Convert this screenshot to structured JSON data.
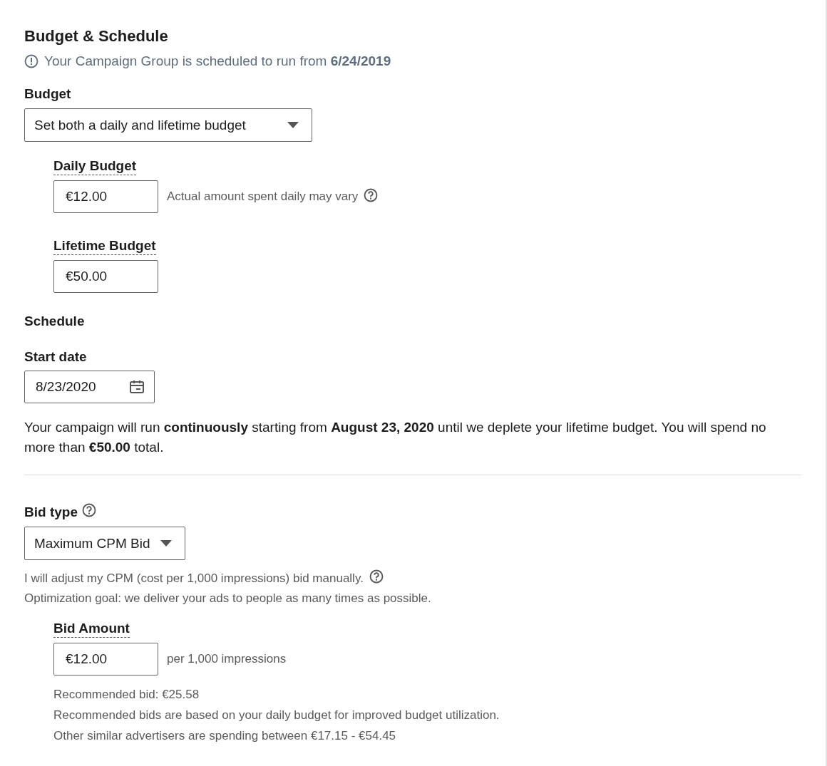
{
  "section": {
    "title": "Budget & Schedule",
    "notice": "Your Campaign Group is scheduled to run from **6/24/2019**"
  },
  "budget": {
    "label": "Budget",
    "select": "Set both a daily and lifetime budget",
    "fields": [
      {
        "label": "Daily Budget",
        "value": "€12.00",
        "hint": "Actual amount spent daily may vary",
        "help": true
      },
      {
        "label": "Lifetime Budget",
        "value": "€50.00",
        "help": false
      }
    ]
  },
  "schedule": {
    "title": "Schedule",
    "start_label": "Start date",
    "start_value": "8/23/2020",
    "summary": "Your campaign will run **continuously** starting from **August 23, 2020** until we deplete your lifetime budget. You will spend no more than **€50.00** total."
  },
  "bid": {
    "label": "Bid type",
    "select": "Maximum CPM Bid",
    "notes": [
      {
        "text": "I will adjust my CPM (cost per 1,000 impressions) bid manually.",
        "help": true
      },
      {
        "text": "Optimization goal: we deliver your ads to people as many times as possible.",
        "help": false
      }
    ],
    "amount": {
      "label": "Bid Amount",
      "value": "€12.00",
      "unit": "per 1,000 impressions",
      "notes": [
        "Recommended bid: €25.58",
        "Recommended bids are based on your daily budget for improved budget utilization.",
        "Other similar advertisers are spending between €17.15 - €54.45"
      ]
    }
  }
}
